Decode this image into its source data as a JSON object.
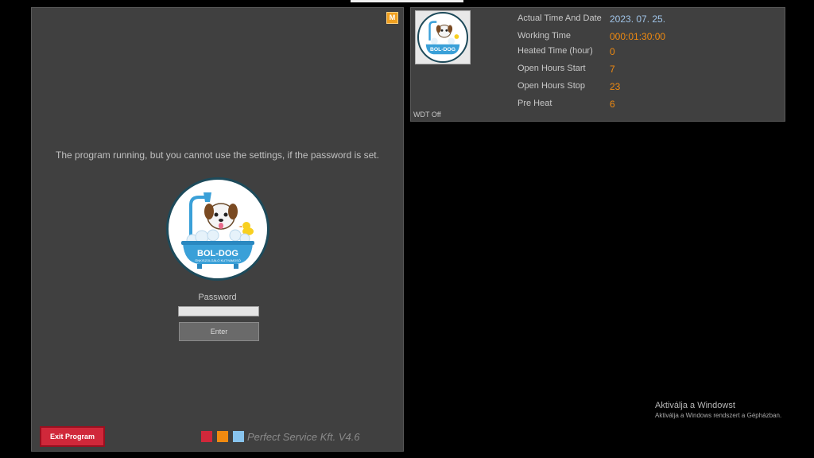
{
  "login": {
    "badge": "M",
    "notice": "The program running, but you cannot use the  settings, if the password  is set.",
    "logo_title": "BOL-DOG",
    "logo_subtitle": "ÖNKISZOLGÁLÓ KUTYAMOSÓ",
    "password_label": "Password",
    "password_value": "",
    "enter_label": "Enter",
    "exit_label": "Exit Program",
    "footer": "Perfect Service Kft.  V4.6"
  },
  "status": {
    "rows": [
      {
        "label": "Actual Time And Date",
        "value": "2023. 07. 25."
      },
      {
        "label": "Working Time",
        "value": "000:01:30:00"
      },
      {
        "label": "Heated Time (hour)",
        "value": "0"
      },
      {
        "label": "Open Hours Start",
        "value": "7"
      },
      {
        "label": "Open Hours Stop",
        "value": "23"
      },
      {
        "label": "Pre Heat",
        "value": "6"
      }
    ],
    "wdt": "WDT Off"
  },
  "watermark": {
    "title": "Aktiválja a Windowst",
    "subtitle": "Aktiválja a Windows rendszert a Gépházban."
  },
  "colors": {
    "panel": "#404040",
    "accent_orange": "#f08a10",
    "accent_red": "#d0283a",
    "accent_blue": "#88c4ee",
    "value_blue": "#a0c4e8"
  }
}
